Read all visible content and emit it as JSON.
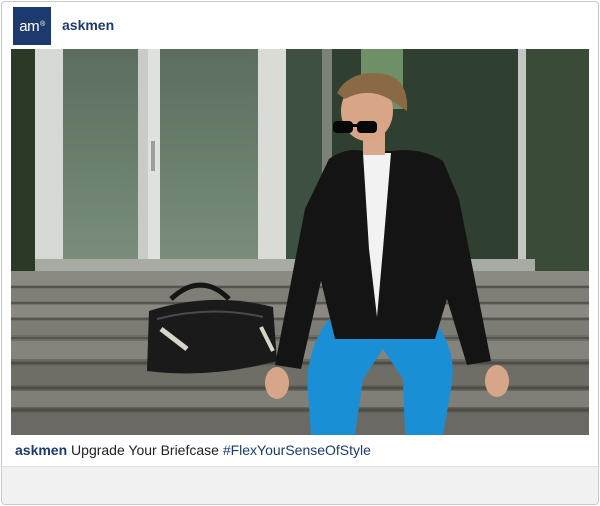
{
  "post": {
    "avatar_text": "am",
    "avatar_mark": "®",
    "username": "askmen",
    "caption_user": "askmen",
    "caption_text": "Upgrade Your Briefcase",
    "caption_hashtag": "#FlexYourSenseOfStyle"
  },
  "colors": {
    "brand": "#1c3a6e",
    "jeans": "#1a8fd6",
    "blazer": "#141414"
  },
  "icons": [
    "registered-mark-icon"
  ]
}
